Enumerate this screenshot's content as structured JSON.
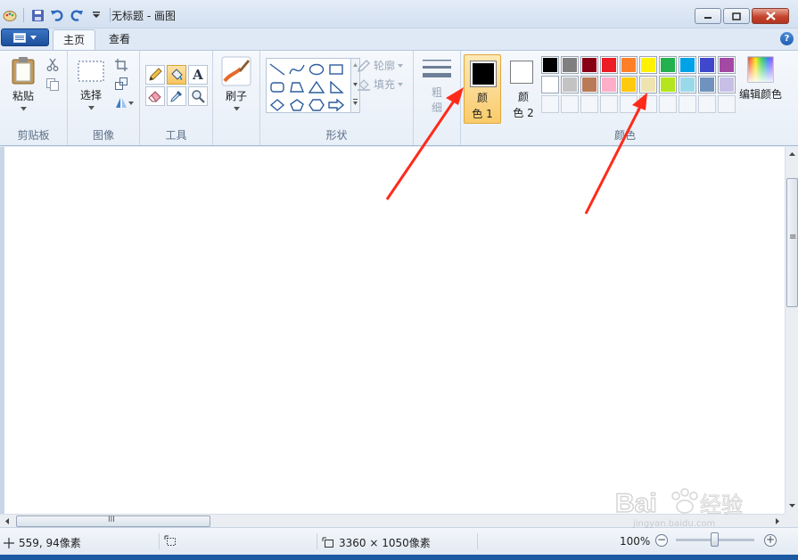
{
  "window": {
    "title": "无标题 - 画图"
  },
  "tabs": [
    {
      "label": "主页"
    },
    {
      "label": "查看"
    }
  ],
  "help_label": "?",
  "ribbon": {
    "clipboard": {
      "label": "剪贴板",
      "paste_label": "粘贴"
    },
    "image": {
      "label": "图像",
      "select_label": "选择"
    },
    "tools": {
      "label": "工具",
      "text_glyph": "A"
    },
    "brushes": {
      "label": "刷子"
    },
    "shapes": {
      "label": "形状",
      "outline_label": "轮廓",
      "fill_label": "填充"
    },
    "size": {
      "label_top": "粗",
      "label_bottom": "细"
    },
    "colors": {
      "label": "颜色",
      "color1": {
        "label_top": "颜",
        "label_bottom": "色 1",
        "value": "#000000"
      },
      "color2": {
        "label_top": "颜",
        "label_bottom": "色 2",
        "value": "#ffffff"
      },
      "edit_label": "编辑颜色",
      "palette_row1": [
        "#000000",
        "#7f7f7f",
        "#880015",
        "#ed1c24",
        "#ff7f27",
        "#fff200",
        "#22b14c",
        "#00a2e8",
        "#3f48cc",
        "#a349a4"
      ],
      "palette_row2": [
        "#ffffff",
        "#c3c3c3",
        "#b97a57",
        "#ffaec9",
        "#ffc90e",
        "#efe4b0",
        "#b5e61d",
        "#99d9ea",
        "#7092be",
        "#c8bfe7"
      ],
      "palette_row3_empty": 10
    }
  },
  "status": {
    "cursor_pos": "559, 94像素",
    "image_size": "3360 × 1050像素",
    "zoom": "100%"
  },
  "scrollbar": {
    "grip": "III",
    "vgrip": "≡"
  },
  "watermark": {
    "text": "Bai 经验",
    "sub": "jingyan.baidu.com"
  },
  "annotation_color": "#ff2a1a"
}
